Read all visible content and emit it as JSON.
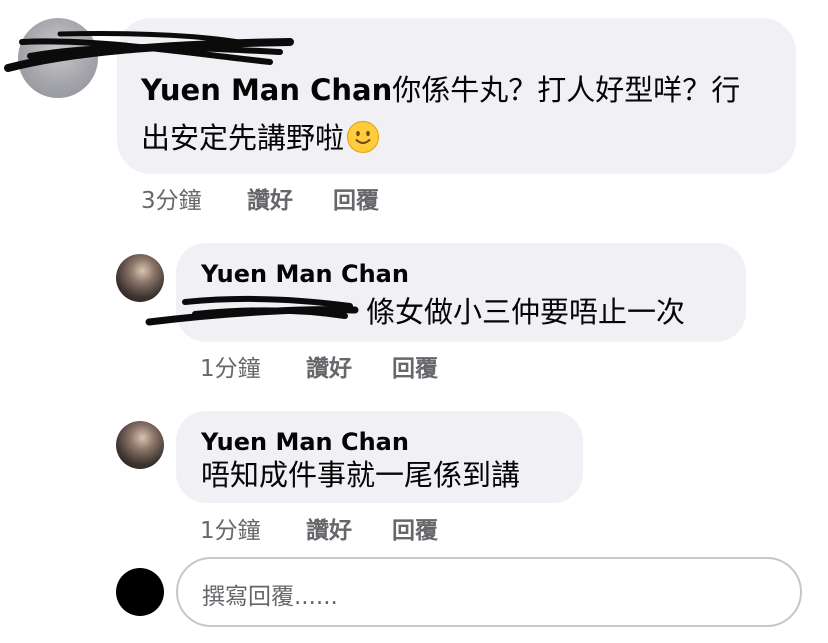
{
  "comment": {
    "author": "Yuen Man Chan",
    "line1_rest": "你係牛丸？打人好型咩？行",
    "line2": "出安定先講野啦",
    "emoji_icon": "slightly-smiling-face-icon",
    "time": "3分鐘",
    "like_label": "讚好",
    "reply_label": "回覆"
  },
  "replies": [
    {
      "author": "Yuen Man Chan",
      "text": "條女做小三仲要唔止一次",
      "time": "1分鐘",
      "like_label": "讚好",
      "reply_label": "回覆"
    },
    {
      "author": "Yuen Man Chan",
      "text": "唔知成件事就一尾係到講",
      "time": "1分鐘",
      "like_label": "讚好",
      "reply_label": "回覆"
    }
  ],
  "composer": {
    "placeholder": "撰寫回覆......"
  },
  "colors": {
    "bubble": "#f0f0f5",
    "meta_text": "#65676b",
    "scribble": "#0b0b0b"
  }
}
